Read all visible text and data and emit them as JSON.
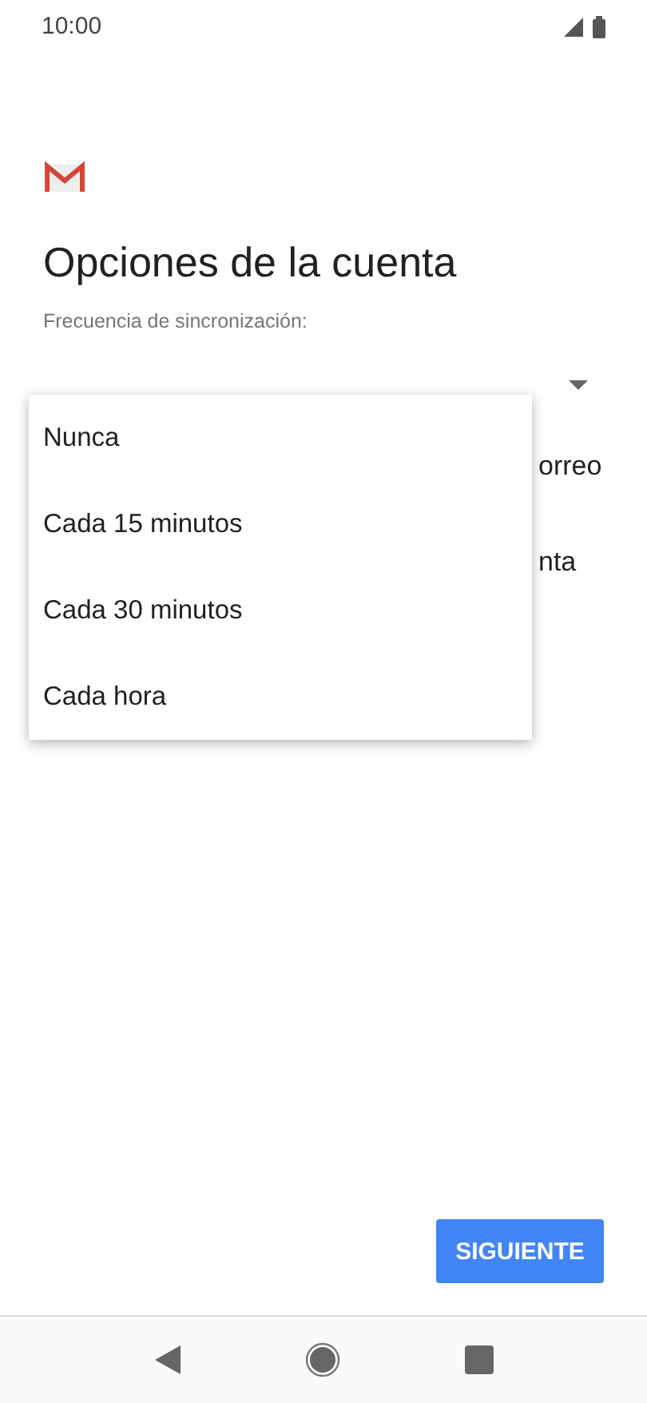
{
  "status_bar": {
    "time": "10:00"
  },
  "title": "Opciones de la cuenta",
  "sync_frequency": {
    "label": "Frecuencia de sincronización:"
  },
  "hidden_rows": [
    "orreo",
    "nta"
  ],
  "menu": {
    "options": [
      {
        "label": "Nunca"
      },
      {
        "label": "Cada 15 minutos"
      },
      {
        "label": "Cada 30 minutos"
      },
      {
        "label": "Cada hora"
      }
    ]
  },
  "next_button": "SIGUIENTE"
}
